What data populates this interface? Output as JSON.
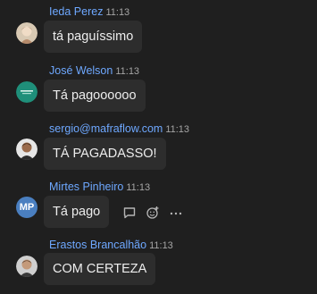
{
  "messages": [
    {
      "author": "Ieda Perez",
      "time": "11:13",
      "text": "tá paguíssimo"
    },
    {
      "author": "José Welson",
      "time": "11:13",
      "text": "Tá pagoooooo"
    },
    {
      "author": "sergio@mafraflow.com",
      "time": "11:13",
      "text": "TÁ PAGADASSO!"
    },
    {
      "author": "Mirtes Pinheiro",
      "time": "11:13",
      "text": "Tá pago",
      "avatar_initials": "MP"
    },
    {
      "author": "Erastos Brancalhão",
      "time": "11:13",
      "text": "COM CERTEZA"
    }
  ],
  "colors": {
    "background": "#1f1f1f",
    "bubble": "#2d2d2d",
    "author": "#6ea8ff",
    "timestamp": "#a6a6a6",
    "avatar_mp": "#4a7fc0"
  },
  "icons": [
    "reply-icon",
    "add-reaction-icon",
    "more-options-icon"
  ]
}
